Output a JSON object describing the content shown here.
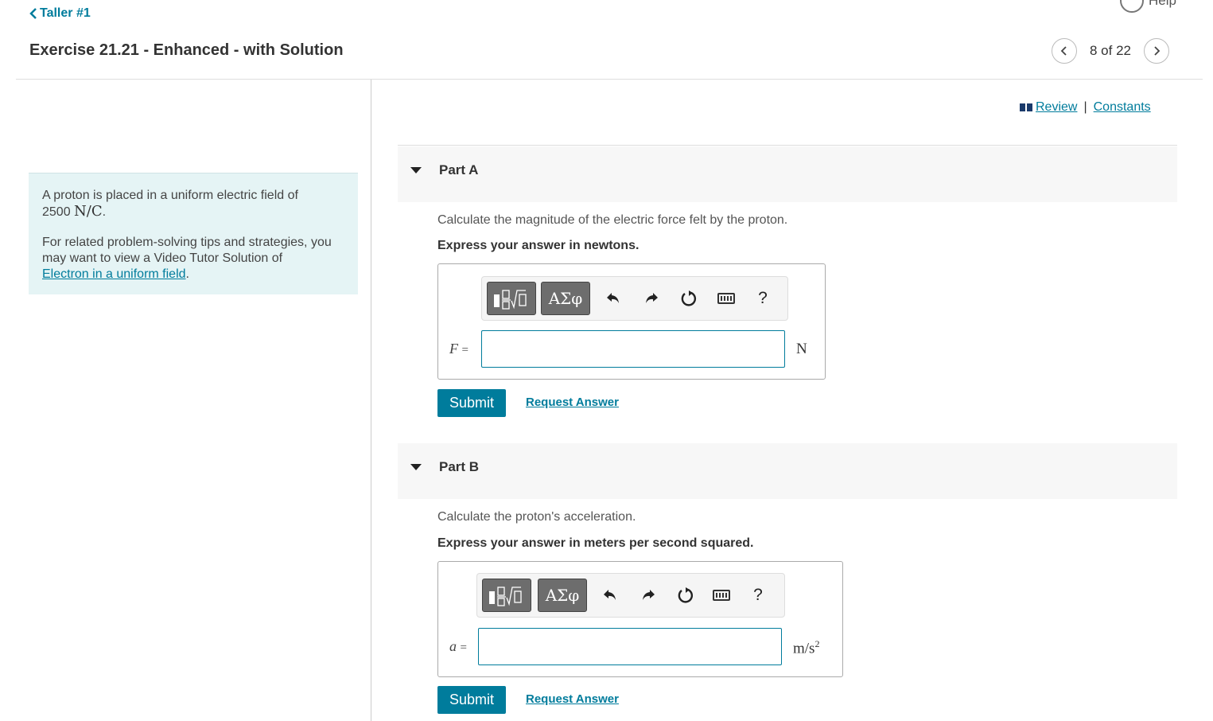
{
  "nav": {
    "back_label": "Taller #1",
    "help_label": "Help"
  },
  "header": {
    "title": "Exercise 21.21 - Enhanced - with Solution",
    "pager_text": "8 of 22"
  },
  "info": {
    "intro": "A proton is placed in a uniform electric field of",
    "field_value": "2500",
    "field_unit": "N/C",
    "period": ".",
    "tip": "For related problem-solving tips and strategies, you may want to view a Video Tutor Solution of",
    "link": "Electron in a uniform field",
    "link_end": "."
  },
  "links": {
    "review": "Review",
    "separator": "|",
    "constants": "Constants"
  },
  "parts": [
    {
      "title": "Part A",
      "question": "Calculate the magnitude of the electric force felt by the proton.",
      "instruction": "Express your answer in newtons.",
      "variable": "F",
      "equals": "=",
      "value": "",
      "unit": "N",
      "unit_sup": "",
      "submit": "Submit",
      "request": "Request Answer"
    },
    {
      "title": "Part B",
      "question": "Calculate the proton's acceleration.",
      "instruction": "Express your answer in meters per second squared.",
      "variable": "a",
      "equals": "=",
      "value": "",
      "unit": "m/s",
      "unit_sup": "2",
      "submit": "Submit",
      "request": "Request Answer"
    }
  ],
  "toolbar": {
    "greek": "ΑΣφ",
    "help": "?"
  }
}
